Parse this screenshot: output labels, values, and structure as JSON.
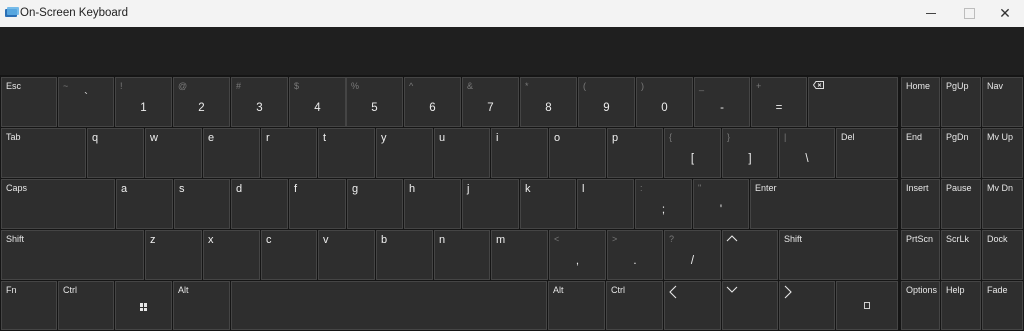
{
  "window": {
    "title": "On-Screen Keyboard",
    "controls": {
      "minimize": "minimize-icon",
      "maximize": "maximize-icon",
      "close": "close-icon"
    },
    "close_label": "✕"
  },
  "keys": {
    "esc": "Esc",
    "grave": {
      "shift": "~",
      "main": "`"
    },
    "d1": {
      "shift": "!",
      "main": "1"
    },
    "d2": {
      "shift": "@",
      "main": "2"
    },
    "d3": {
      "shift": "#",
      "main": "3"
    },
    "d4": {
      "shift": "$",
      "main": "4"
    },
    "d5": {
      "shift": "%",
      "main": "5"
    },
    "d6": {
      "shift": "^",
      "main": "6"
    },
    "d7": {
      "shift": "&",
      "main": "7"
    },
    "d8": {
      "shift": "*",
      "main": "8"
    },
    "d9": {
      "shift": "(",
      "main": "9"
    },
    "d0": {
      "shift": ")",
      "main": "0"
    },
    "minus": {
      "shift": "_",
      "main": "-"
    },
    "equals": {
      "shift": "+",
      "main": "="
    },
    "backspace": "backspace-icon",
    "tab": "Tab",
    "q": "q",
    "w": "w",
    "e": "e",
    "r": "r",
    "t": "t",
    "y": "y",
    "u": "u",
    "i": "i",
    "o": "o",
    "p": "p",
    "lbracket": {
      "shift": "{",
      "main": "["
    },
    "rbracket": {
      "shift": "}",
      "main": "]"
    },
    "backslash": {
      "shift": "|",
      "main": "\\"
    },
    "del": "Del",
    "caps": "Caps",
    "a": "a",
    "s": "s",
    "d": "d",
    "f": "f",
    "g": "g",
    "h": "h",
    "j": "j",
    "k": "k",
    "l": "l",
    "semicolon": {
      "shift": ":",
      "main": ";"
    },
    "quote": {
      "shift": "\"",
      "main": "'"
    },
    "enter": "Enter",
    "shift_left": "Shift",
    "z": "z",
    "x": "x",
    "c": "c",
    "v": "v",
    "b": "b",
    "n": "n",
    "m": "m",
    "comma": {
      "shift": "<",
      "main": ","
    },
    "period": {
      "shift": ">",
      "main": "."
    },
    "slash": {
      "shift": "?",
      "main": "/"
    },
    "up": "^",
    "shift_right": "Shift",
    "fn": "Fn",
    "ctrl_left": "Ctrl",
    "win": "windows-icon",
    "alt_left": "Alt",
    "space": "",
    "alt_right": "Alt",
    "ctrl_right": "Ctrl",
    "left": "<",
    "down": "v",
    "right": ">",
    "menu": "menu-icon",
    "home": "Home",
    "pgup": "PgUp",
    "nav": "Nav",
    "end": "End",
    "pgdn": "PgDn",
    "mvup": "Mv Up",
    "insert": "Insert",
    "pause": "Pause",
    "mvdn": "Mv Dn",
    "prtscn": "PrtScn",
    "scrlk": "ScrLk",
    "dock": "Dock",
    "options": "Options",
    "help": "Help",
    "fade": "Fade"
  }
}
